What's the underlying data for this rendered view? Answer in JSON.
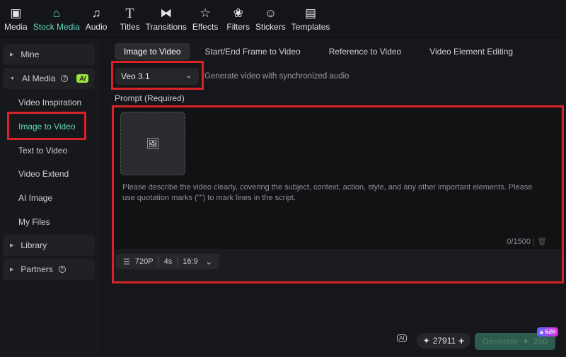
{
  "toolbar": [
    {
      "label": "Media",
      "icon": "media-icon"
    },
    {
      "label": "Stock Media",
      "icon": "stock-media-icon",
      "active": true
    },
    {
      "label": "Audio",
      "icon": "audio-icon"
    },
    {
      "label": "Titles",
      "icon": "titles-icon"
    },
    {
      "label": "Transitions",
      "icon": "transitions-icon"
    },
    {
      "label": "Effects",
      "icon": "effects-icon"
    },
    {
      "label": "Filters",
      "icon": "filters-icon"
    },
    {
      "label": "Stickers",
      "icon": "stickers-icon"
    },
    {
      "label": "Templates",
      "icon": "templates-icon"
    }
  ],
  "sidebar": {
    "mine": "Mine",
    "ai_media": "AI Media",
    "ai_badge": "AI",
    "items": [
      "Video Inspiration",
      "Image to Video",
      "Text to Video",
      "Video Extend",
      "AI Image",
      "My Files"
    ],
    "library": "Library",
    "partners": "Partners"
  },
  "tabs": [
    "Image to Video",
    "Start/End Frame to Video",
    "Reference to Video",
    "Video Element Editing"
  ],
  "model": {
    "value": "Veo 3.1",
    "description": "Generate video with synchronized audio"
  },
  "prompt": {
    "label": "Prompt (Required)",
    "placeholder": "Please describe the video clearly, covering the subject, context, action, style, and any other important elements. Please use quotation marks (\"\") to mark lines in the script.",
    "count": "0/1500"
  },
  "options": {
    "resolution": "720P",
    "duration": "4s",
    "ratio": "16:9"
  },
  "footer": {
    "credits": "27911",
    "generate": "Generate",
    "cost": "250",
    "badge": "620"
  },
  "colors": {
    "accent": "#5fd8c0",
    "highlight": "#d8222a"
  }
}
